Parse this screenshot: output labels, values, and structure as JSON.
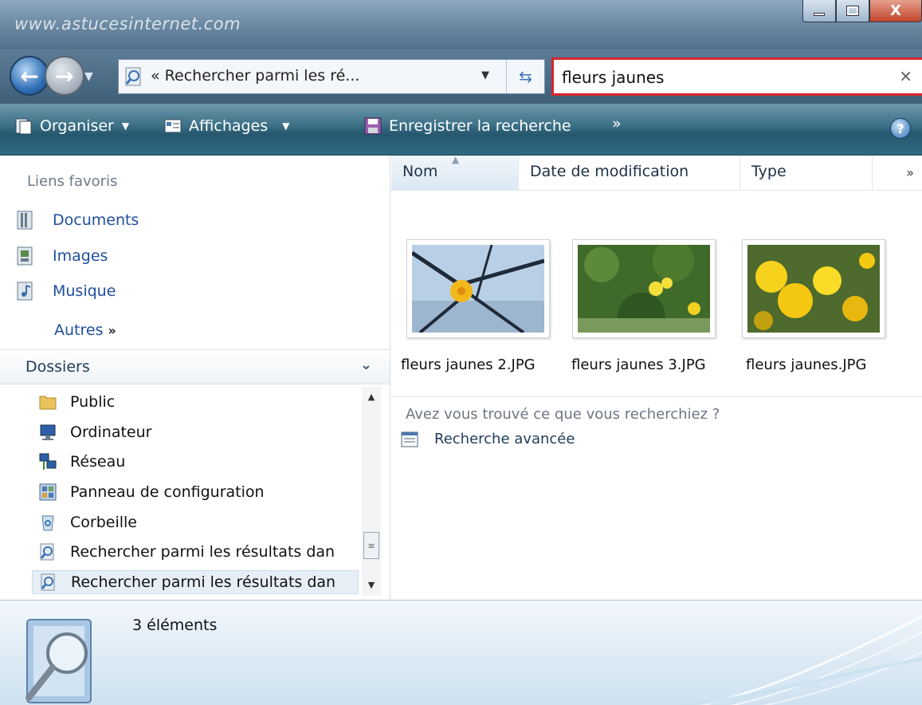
{
  "window": {
    "watermark": "www.astucesinternet.com"
  },
  "navigation": {
    "address": "« Rechercher parmi les ré...",
    "search_value": "fleurs jaunes",
    "search_clear": "×"
  },
  "toolbar": {
    "organiser": "Organiser",
    "affichages": "Affichages",
    "enregistrer": "Enregistrer la recherche",
    "more": "»",
    "help": "?"
  },
  "favorites": {
    "heading": "Liens favoris",
    "items": [
      {
        "label": "Documents",
        "icon": "documents-icon"
      },
      {
        "label": "Images",
        "icon": "images-icon"
      },
      {
        "label": "Musique",
        "icon": "music-icon"
      }
    ],
    "more_label": "Autres",
    "more_glyph": "»"
  },
  "folders": {
    "heading": "Dossiers",
    "items": [
      {
        "label": "Public",
        "icon": "folder-icon"
      },
      {
        "label": "Ordinateur",
        "icon": "computer-icon"
      },
      {
        "label": "Réseau",
        "icon": "network-icon"
      },
      {
        "label": "Panneau de configuration",
        "icon": "control-panel-icon"
      },
      {
        "label": "Corbeille",
        "icon": "recycle-bin-icon"
      },
      {
        "label": "Rechercher parmi les résultats dan",
        "icon": "saved-search-icon"
      },
      {
        "label": "Rechercher parmi les résultats dan",
        "icon": "saved-search-icon"
      }
    ]
  },
  "columns": {
    "name": "Nom",
    "date": "Date de modification",
    "type": "Type",
    "more": "»"
  },
  "files": [
    {
      "name": "fleurs jaunes 2.JPG"
    },
    {
      "name": "fleurs jaunes 3.JPG"
    },
    {
      "name": "fleurs jaunes.JPG"
    }
  ],
  "search_help": {
    "question": "Avez vous trouvé ce que vous recherchiez ?",
    "advanced": "Recherche avancée"
  },
  "details": {
    "count": "3 éléments"
  },
  "colors": {
    "search_border": "#d8262e",
    "toolbar": "#2d6a82",
    "link": "#1f4e9c"
  }
}
